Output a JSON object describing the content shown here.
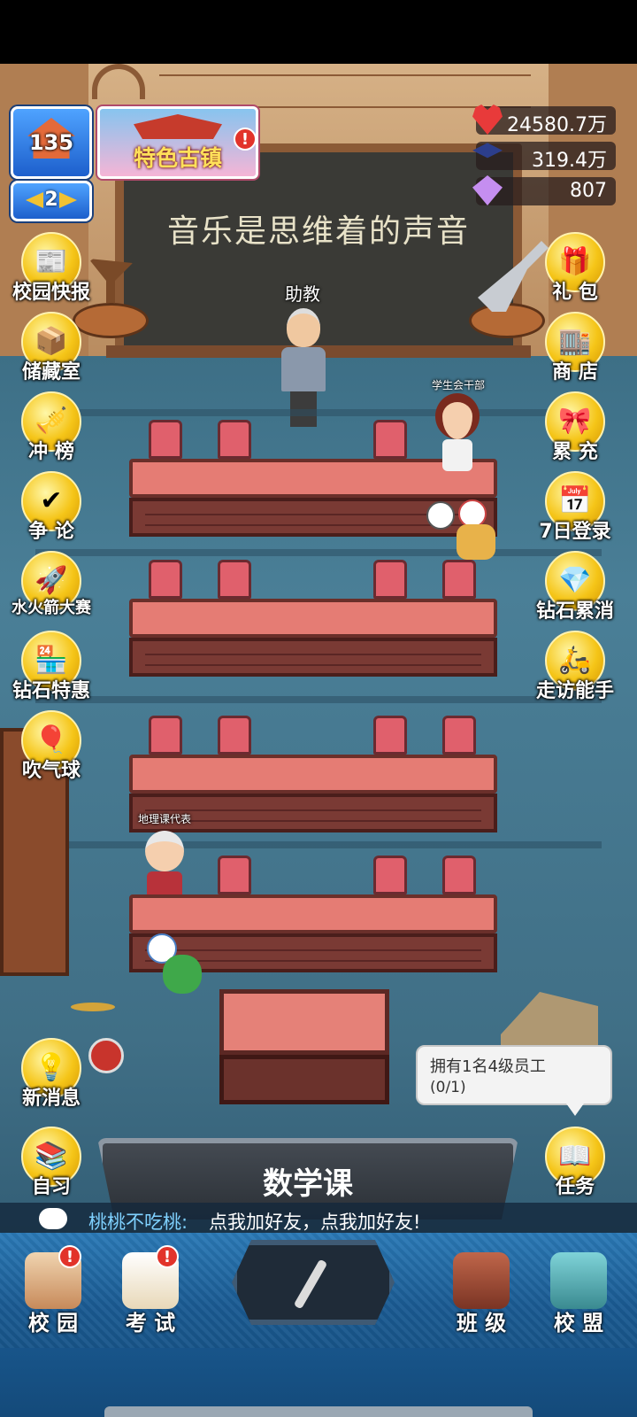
{
  "hud": {
    "level": "135",
    "rank": "2",
    "event_banner": "特色古镇",
    "event_badge": "!",
    "resources": {
      "hearts": "24580.7万",
      "caps": "319.4万",
      "diamonds": "807"
    }
  },
  "scene": {
    "blackboard_text": "音乐是思维着的声音",
    "characters": {
      "assistant": "助教",
      "student_council": "学生会干部",
      "geography_rep": "地理课代表"
    }
  },
  "left_menu": [
    {
      "label": "校园快报",
      "icon": "newspaper-icon"
    },
    {
      "label": "储藏室",
      "icon": "storage-icon"
    },
    {
      "label": "冲 榜",
      "icon": "trumpet-icon"
    },
    {
      "label": "争 论",
      "icon": "debate-icon"
    },
    {
      "label": "水火箭大赛",
      "icon": "rocket-icon"
    },
    {
      "label": "钻石特惠",
      "icon": "diamond-shop-icon"
    },
    {
      "label": "吹气球",
      "icon": "balloon-icon"
    }
  ],
  "right_menu": [
    {
      "label": "礼 包",
      "icon": "gift-icon"
    },
    {
      "label": "商 店",
      "icon": "shop-icon"
    },
    {
      "label": "累 充",
      "icon": "giftbox-icon"
    },
    {
      "label": "7日登录",
      "icon": "calendar-icon"
    },
    {
      "label": "钻石累消",
      "icon": "gem-icon"
    },
    {
      "label": "走访能手",
      "icon": "visitor-icon"
    }
  ],
  "bottom_left_buttons": {
    "news": "新消息",
    "study": "自习"
  },
  "task": {
    "text": "拥有1名4级员工",
    "progress": "(0/1)",
    "button": "任务"
  },
  "class_name": "数学课",
  "chat": {
    "name": "桃桃不吃桃:",
    "message": "点我加好友，点我加好友!"
  },
  "nav": {
    "campus": "校 园",
    "exam": "考 试",
    "class": "班 级",
    "alliance": "校 盟",
    "badge": "!"
  },
  "colors": {
    "desk": "#e57c74",
    "chair": "#e0606c",
    "floor": "#4a7f97",
    "nav": "#1a5b93",
    "button_gold": "#f5c518"
  }
}
